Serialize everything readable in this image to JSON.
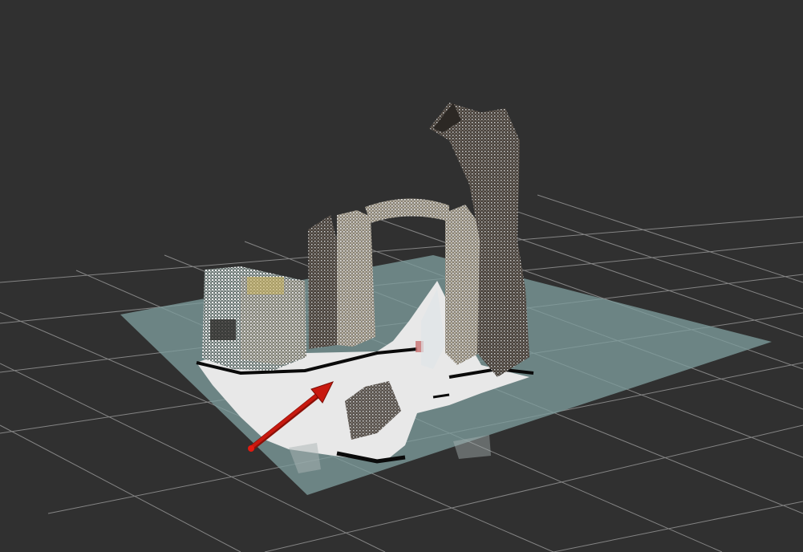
{
  "viewer": {
    "background_color": "#303030",
    "grid_color": "#a0a0a0",
    "map_color": "#6e8c8c",
    "map_free_color": "#e6e6e6",
    "map_occupied_color": "#0a0a0a",
    "arrow_color": "#c8190f",
    "pointcloud_palette": [
      "#e6e6e6",
      "#b4aa96",
      "#8c8278",
      "#6e645a",
      "#cfcfcf",
      "#5a504a",
      "#3c3632"
    ]
  },
  "scene": {
    "pose_arrow": {
      "icon": "arrow-icon"
    },
    "grid": {
      "icon": "grid-icon"
    },
    "occupancy_map": {
      "icon": "map-icon"
    },
    "point_cloud": {
      "icon": "point-cloud-icon"
    }
  }
}
